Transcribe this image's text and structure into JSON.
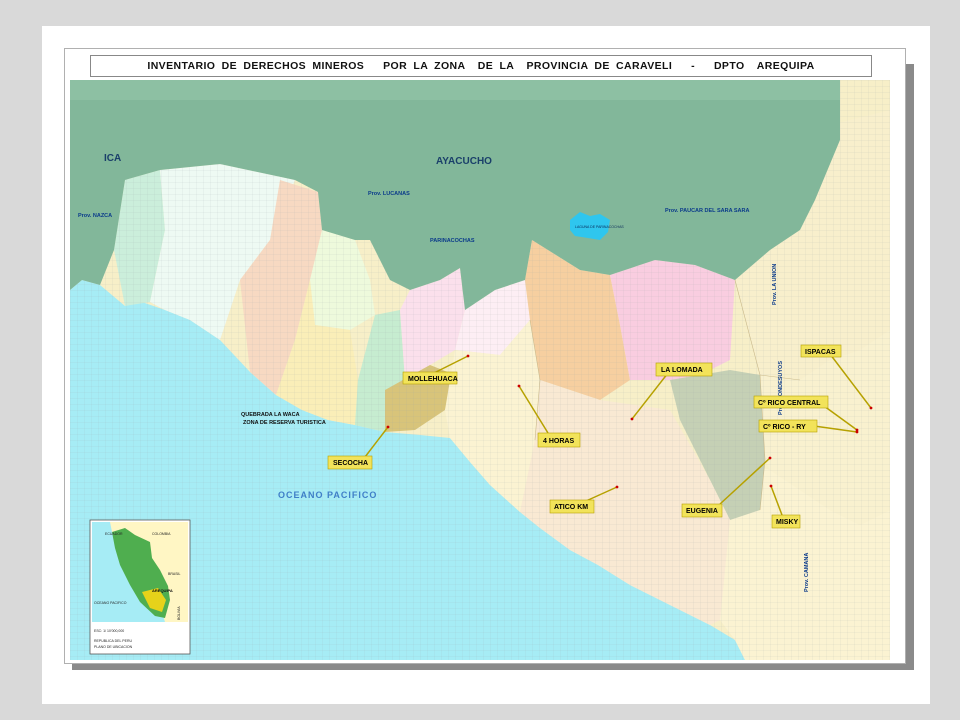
{
  "title": "INVENTARIO DE DERECHOS MINEROS   POR LA ZONA  DE LA  PROVINCIA DE CARAVELI   -   DPTO  AREQUIPA",
  "colors": {
    "ocean": "#a6ecf5",
    "highlands": "#82b79a",
    "lagoon": "#2fc6ee",
    "callout_box": "#f2e35a",
    "callout_border": "#b6a100",
    "region_label": "#0a3a8a"
  },
  "regions": {
    "ica": "ICA",
    "ayacucho": "AYACUCHO",
    "ocean": "OCEANO PACIFICO",
    "lagoon": "LAGUNA DE PARINACOCHAS"
  },
  "provinces": {
    "nazca": "Prov. NAZCA",
    "lucanas": "Prov. LUCANAS",
    "parinacochas": "PARINACOCHAS",
    "paucar": "Prov. PAUCAR DEL SARA SARA",
    "la_union": "Prov. LA UNION",
    "condesuyos": "Prov. CONDESUYOS",
    "camana": "Prov. CAMANA"
  },
  "annotation": {
    "line1": "QUEBRADA LA WACA",
    "line2": "ZONA DE RESERVA TURISTICA"
  },
  "callouts": [
    {
      "id": "mollehuaca",
      "label": "MOLLEHUACA"
    },
    {
      "id": "la-lomada",
      "label": "LA LOMADA"
    },
    {
      "id": "ispacas",
      "label": "ISPACAS"
    },
    {
      "id": "rico-central",
      "label": "Cº RICO CENTRAL"
    },
    {
      "id": "rico-ry",
      "label": "Cº RICO - RY"
    },
    {
      "id": "4-horas",
      "label": "4 HORAS"
    },
    {
      "id": "secocha",
      "label": "SECOCHA"
    },
    {
      "id": "atico-km",
      "label": "ATICO KM"
    },
    {
      "id": "eugenia",
      "label": "EUGENIA"
    },
    {
      "id": "misky",
      "label": "MISKY"
    }
  ],
  "inset": {
    "countries": {
      "ecuador": "ECUADOR",
      "colombia": "COLOMBIA",
      "brasil": "BRASIL",
      "bolivia": "BOLIVIA"
    },
    "ocean": "OCEANO PACIFICO",
    "highlight": "AREQUIPA",
    "scale": "ESC: 1/ 10'000,000",
    "caption1": "REPUBLICA DEL PERU",
    "caption2": "PLANO DE UBICACION"
  }
}
